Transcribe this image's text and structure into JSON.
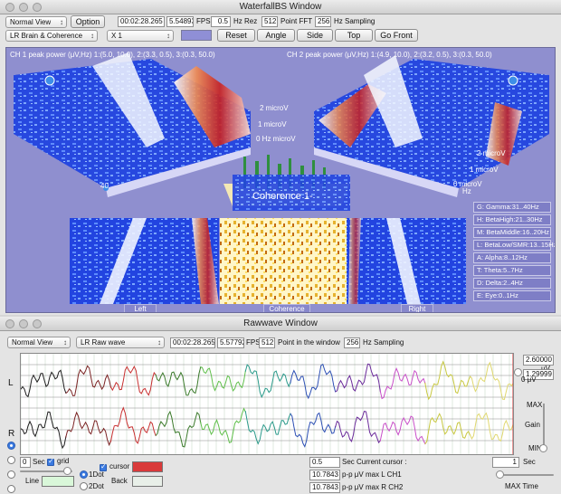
{
  "waterfall": {
    "title": "WaterfallBS Window",
    "view_select": "Normal View",
    "option_button": "Option",
    "time": "00:02:28.265",
    "fps_value": "5.54893",
    "fps_label": "FPS",
    "hz_rez_value": "0.5",
    "hz_rez_label": "Hz Rez",
    "fft_value": "512",
    "fft_label": "Point FFT",
    "sampling_value": "256",
    "sampling_label": "Hz Sampling",
    "mode_select": "LR Brain & Coherence",
    "zoom_select": "X 1",
    "reset_button": "Reset",
    "angle_button": "Angle",
    "side_button": "Side",
    "top_button": "Top",
    "go_front_button": "Go Front",
    "ch1_header": "CH 1 peak power (μV,Hz) 1:(5.0, 10.0), 2:(3.3, 0.5), 3:(0.3, 50.0)",
    "ch2_header": "CH 2 peak power (μV,Hz) 1:(4.9, 10.0), 2:(3.2, 0.5), 3:(0.3, 50.0)",
    "left_scale": [
      "2 microV",
      "1 microV",
      "0 Hz microV"
    ],
    "right_scale": [
      "2 microV",
      "1 microV",
      "0 microV"
    ],
    "coherence_label": "Coherence 1-",
    "panel_left": "Left",
    "panel_coherence": "Coherence",
    "panel_right": "Right",
    "bands": [
      "G: Gamma:31..40Hz",
      "H: BetaHigh:21..30Hz",
      "M: BetaMiddle:16..20Hz",
      "L: BetaLow/SMR:13..15Hz",
      "A: Alpha:8..12Hz",
      "T: Theta:5..7Hz",
      "D: Delta:2..4Hz",
      "E: Eye:0..1Hz"
    ],
    "tick_40": "40",
    "tick_hz": "Hz"
  },
  "rawwave": {
    "title": "Rawwave Window",
    "view_select": "Normal View",
    "mode_select": "LR Raw wave",
    "time": "00:02:28.265",
    "fps_value": "5.57792",
    "fps_label": "FPS",
    "points_value": "512",
    "points_label": "Point in the window",
    "sampling_value": "256",
    "sampling_label": "Hz Sampling",
    "channel_left": "L",
    "channel_right": "R",
    "uv_top": "2.60000",
    "uv_unit": "μV",
    "uv_mid": "1.29999",
    "uv_zero": "0 μV",
    "max_label": "MAX",
    "gain_label": "Gain",
    "min_label": "MIN",
    "sec_value": "0",
    "sec_label": "Sec",
    "grid_label": "grid",
    "cursor_label": "cursor",
    "line_label": "Line",
    "back_label": "Back",
    "dot1_label": "1Dot",
    "dot2_label": "2Dot",
    "current_value": "0.5",
    "current_label": "Sec Current cursor :",
    "ch1_value": "10.7843",
    "ch1_label": "p-p μV max L CH1",
    "ch2_value": "10.7843",
    "ch2_label": "p-p μV max R CH2",
    "max_time_value": "1",
    "max_time_unit": "Sec",
    "max_time_label": "MAX Time",
    "cursor_color": "#d93a3a",
    "line_color": "#d9f7d9",
    "back_color": "#e8efe8"
  }
}
